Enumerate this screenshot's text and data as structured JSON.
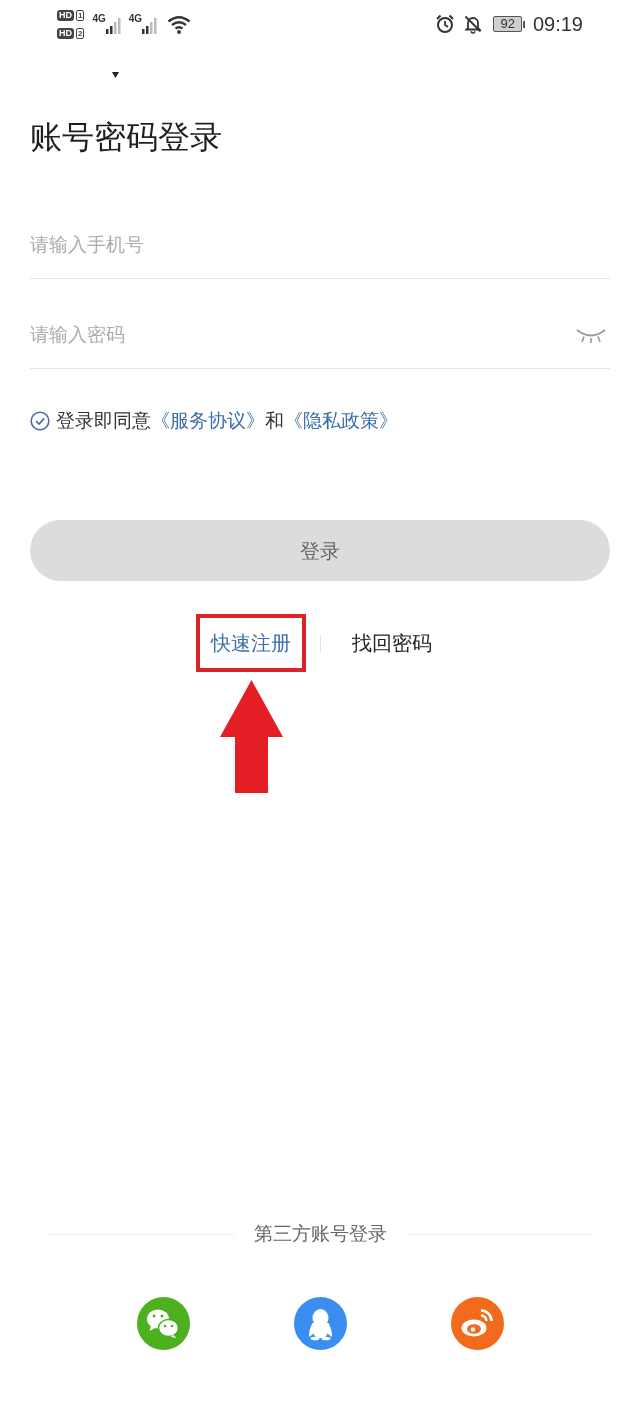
{
  "status_bar": {
    "sims": [
      {
        "badge": "HD",
        "slot": "1"
      },
      {
        "badge": "HD",
        "slot": "2"
      }
    ],
    "networks": [
      {
        "label": "4G"
      },
      {
        "label": "4G"
      }
    ],
    "alarm": true,
    "silent": true,
    "battery": "92",
    "time": "09:19"
  },
  "title": "账号密码登录",
  "fields": [
    {
      "kind": "phone",
      "placeholder": "请输入手机号"
    },
    {
      "kind": "password",
      "placeholder": "请输入密码",
      "visible": false
    }
  ],
  "agreement": {
    "checked": true,
    "parts": [
      {
        "kind": "text",
        "text": "登录即同意"
      },
      {
        "kind": "link",
        "text": "《服务协议》"
      },
      {
        "kind": "text",
        "text": "和"
      },
      {
        "kind": "link",
        "text": "《隐私政策》"
      }
    ]
  },
  "login_button": {
    "label": "登录",
    "disabled": true
  },
  "links": [
    {
      "label": "快速注册",
      "kind": "accent",
      "highlighted": true
    },
    {
      "label": "找回密码",
      "kind": "plain",
      "highlighted": false
    }
  ],
  "third_party": {
    "title": "第三方账号登录",
    "providers": [
      {
        "kind": "wechat",
        "color": "#4cb01f"
      },
      {
        "kind": "qq",
        "color": "#3a8ef0"
      },
      {
        "kind": "weibo",
        "color": "#f26a1c"
      }
    ]
  }
}
